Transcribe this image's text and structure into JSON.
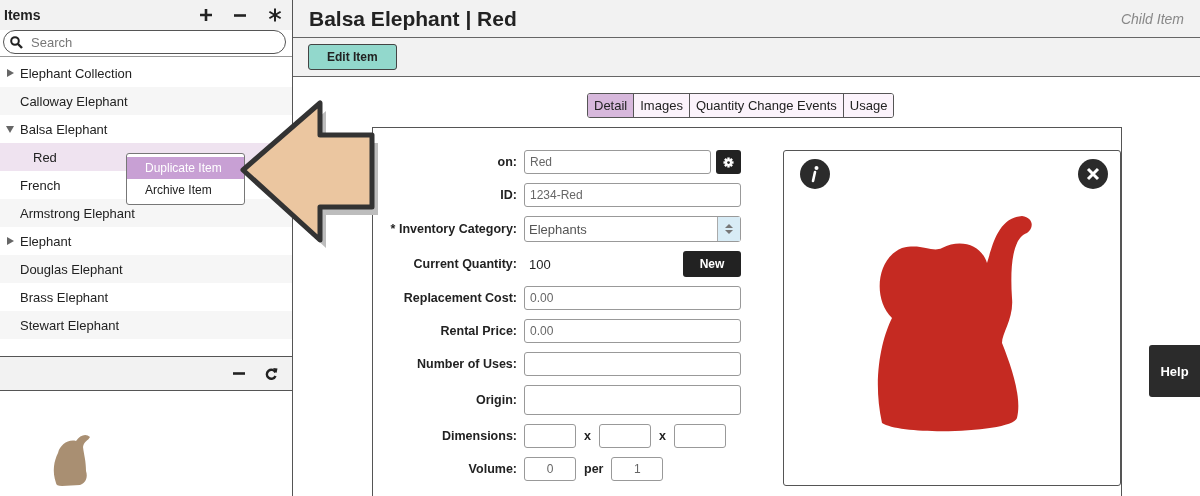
{
  "sidebar": {
    "title": "Items",
    "search": {
      "placeholder": "Search"
    },
    "tree": [
      {
        "label": "Elephant Collection",
        "expanded": false,
        "selected": false
      },
      {
        "label": "Calloway Elephant",
        "selected": false
      },
      {
        "label": "Balsa Elephant",
        "expanded": true,
        "selected": false,
        "children": [
          {
            "label": "Red",
            "selected": true
          }
        ]
      },
      {
        "label": "French",
        "selected": false
      },
      {
        "label": "Armstrong Elephant",
        "selected": false
      },
      {
        "label": "Elephant",
        "expanded": false,
        "selected": false
      },
      {
        "label": "Douglas Elephant",
        "selected": false
      },
      {
        "label": "Brass Elephant",
        "selected": false
      },
      {
        "label": "Stewart Elephant",
        "selected": false
      }
    ],
    "context_menu": [
      {
        "label": "Duplicate Item",
        "selected": true
      },
      {
        "label": "Archive Item",
        "selected": false
      }
    ]
  },
  "main": {
    "title": "Balsa Elephant | Red",
    "subtitle": "Child Item",
    "edit_button": "Edit Item",
    "tabs": [
      {
        "label": "Detail",
        "selected": true
      },
      {
        "label": "Images",
        "selected": false
      },
      {
        "label": "Quantity Change Events",
        "selected": false
      },
      {
        "label": "Usage",
        "selected": false
      }
    ],
    "fields": [
      {
        "kind": "input_gear",
        "label": "on:",
        "value": "Red"
      },
      {
        "kind": "input",
        "label": "ID:",
        "value": "1234-Red"
      },
      {
        "kind": "select",
        "label": "* Inventory Category:",
        "value": "Elephants"
      },
      {
        "kind": "quantity",
        "label": "Current Quantity:",
        "value": "100",
        "button": "New"
      },
      {
        "kind": "input",
        "label": "Replacement Cost:",
        "value": "0.00"
      },
      {
        "kind": "input",
        "label": "Rental Price:",
        "value": "0.00"
      },
      {
        "kind": "input",
        "label": "Number of Uses:"
      },
      {
        "kind": "tall",
        "label": "Origin:"
      },
      {
        "kind": "triple",
        "label": "Dimensions:",
        "separators": [
          "x",
          "x"
        ]
      },
      {
        "kind": "ratio",
        "label": "Volume:",
        "values": [
          "0",
          "1"
        ],
        "separator": "per"
      }
    ]
  },
  "help_button": "Help"
}
